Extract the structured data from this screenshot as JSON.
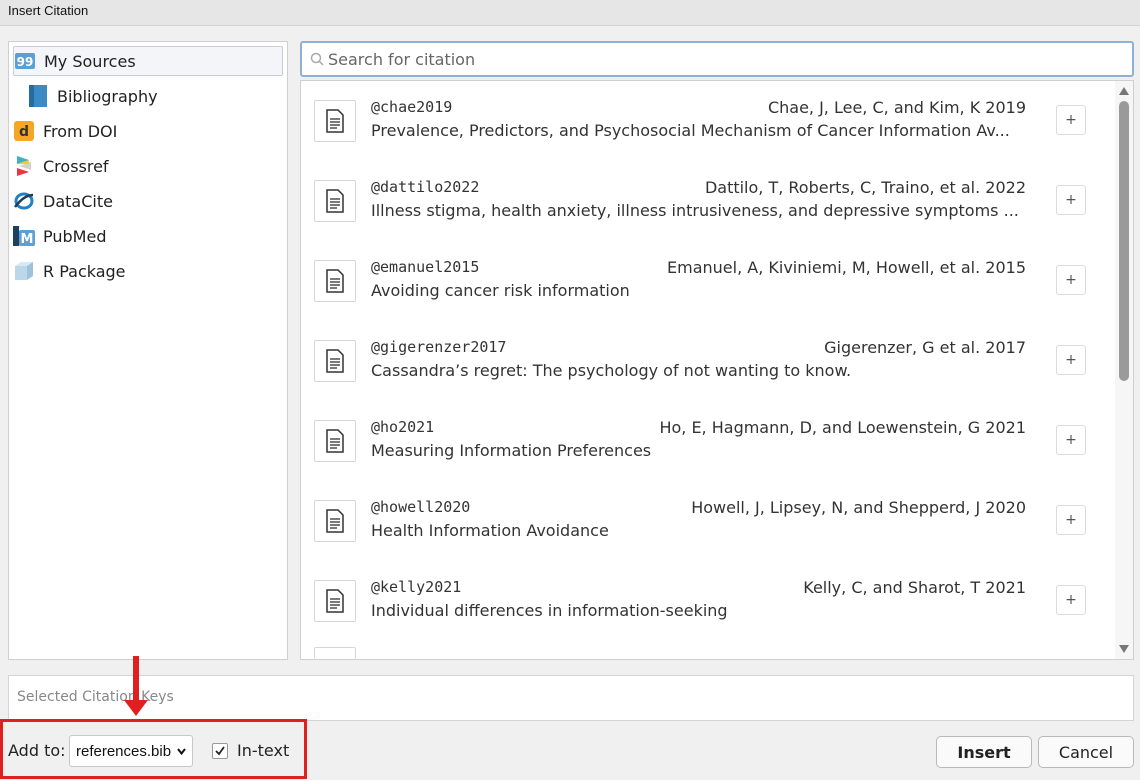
{
  "window": {
    "title": "Insert Citation"
  },
  "sources": [
    {
      "label": "My Sources",
      "icon": "my-sources-icon",
      "selected": true
    },
    {
      "label": "Bibliography",
      "icon": "bibliography-icon",
      "selected": false
    },
    {
      "label": "From DOI",
      "icon": "doi-icon",
      "selected": false
    },
    {
      "label": "Crossref",
      "icon": "crossref-icon",
      "selected": false
    },
    {
      "label": "DataCite",
      "icon": "datacite-icon",
      "selected": false
    },
    {
      "label": "PubMed",
      "icon": "pubmed-icon",
      "selected": false
    },
    {
      "label": "R Package",
      "icon": "r-package-icon",
      "selected": false
    }
  ],
  "search": {
    "placeholder": "Search for citation",
    "value": ""
  },
  "results": [
    {
      "key": "@chae2019",
      "authors": "Chae, J, Lee, C, and Kim, K 2019",
      "title": "Prevalence, Predictors, and Psychosocial Mechanism of Cancer Information Av..."
    },
    {
      "key": "@dattilo2022",
      "authors": "Dattilo, T, Roberts, C, Traino, et al. 2022",
      "title": "Illness stigma, health anxiety, illness intrusiveness, and depressive symptoms ..."
    },
    {
      "key": "@emanuel2015",
      "authors": "Emanuel, A, Kiviniemi, M, Howell, et al. 2015",
      "title": "Avoiding cancer risk information"
    },
    {
      "key": "@gigerenzer2017",
      "authors": "Gigerenzer, G et al. 2017",
      "title": "Cassandra’s regret: The psychology of not wanting to know."
    },
    {
      "key": "@ho2021",
      "authors": "Ho, E, Hagmann, D, and Loewenstein, G 2021",
      "title": "Measuring Information Preferences"
    },
    {
      "key": "@howell2020",
      "authors": "Howell, J, Lipsey, N, and Shepperd, J 2020",
      "title": "Health Information Avoidance"
    },
    {
      "key": "@kelly2021",
      "authors": "Kelly, C, and Sharot, T 2021",
      "title": "Individual differences in information-seeking"
    }
  ],
  "add_button_label": "+",
  "selected_keys": {
    "placeholder": "Selected Citation Keys"
  },
  "footer": {
    "add_to_label": "Add to:",
    "add_to_value": "references.bib",
    "in_text_label": "In-text",
    "in_text_checked": true,
    "insert_label": "Insert",
    "cancel_label": "Cancel"
  },
  "colors": {
    "annotation": "#e02020",
    "focus_border": "#8fb1d8"
  }
}
